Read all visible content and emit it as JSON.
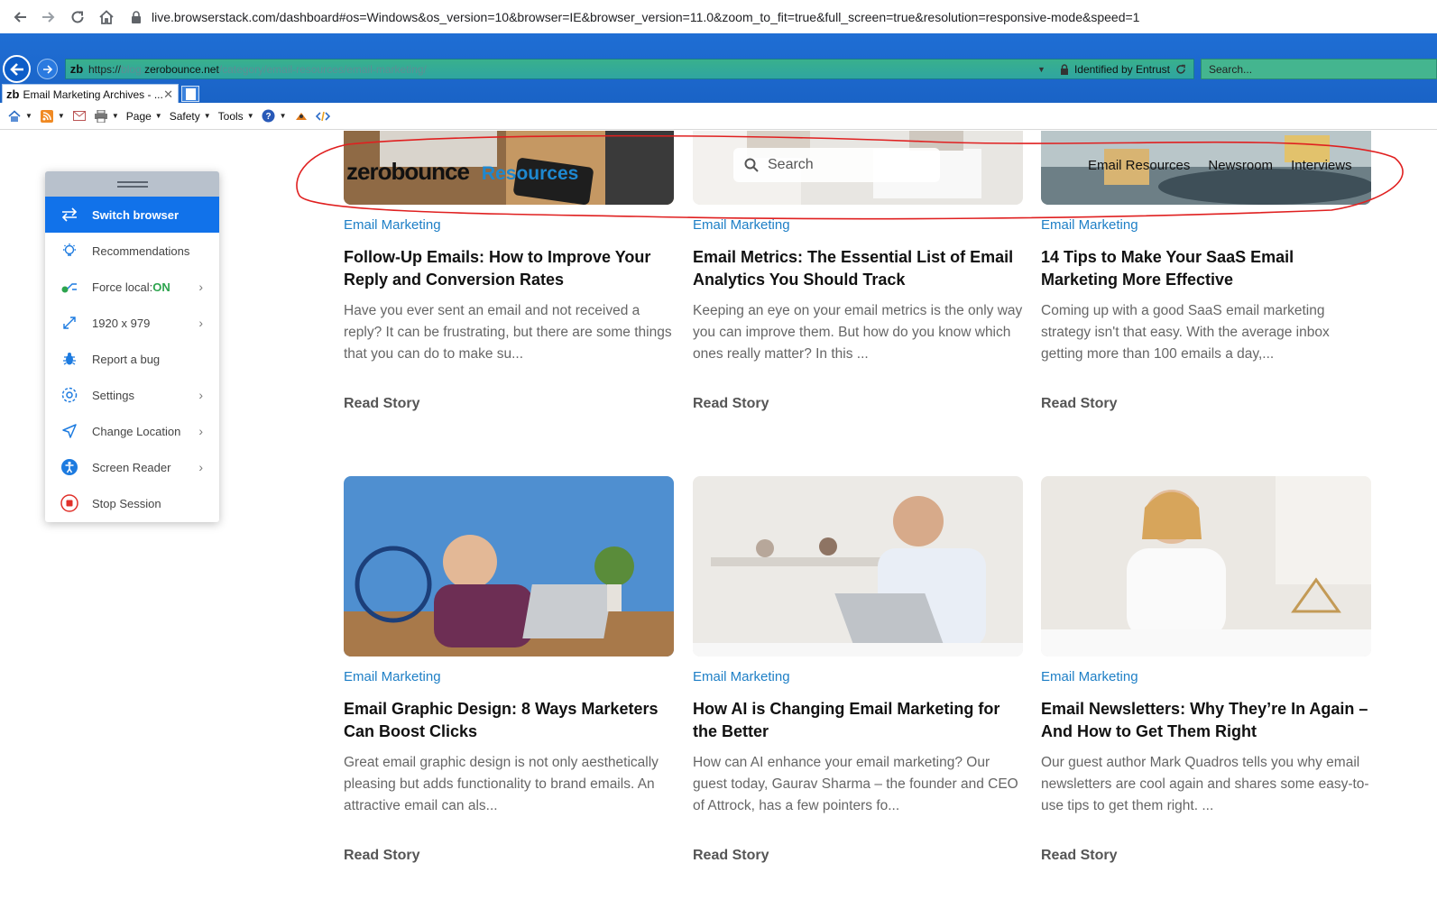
{
  "chrome": {
    "url": "live.browserstack.com/dashboard#os=Windows&os_version=10&browser=IE&browser_version=11.0&zoom_to_fit=true&full_screen=true&resolution=responsive-mode&speed=1"
  },
  "ie": {
    "address": {
      "scheme": "https://",
      "subdomain": "blog.",
      "domain": "zerobounce.net",
      "path": "/category/email-resources/email-marketing/",
      "identity": "Identified by Entrust"
    },
    "search_placeholder": "Search...",
    "tab": {
      "favicon": "zb",
      "title": "Email Marketing Archives - ..."
    },
    "commandbar": {
      "page": "Page",
      "safety": "Safety",
      "tools": "Tools"
    }
  },
  "site": {
    "logo": "zerobounce",
    "logo_suffix": "Resources",
    "search_placeholder": "Search",
    "nav": [
      "Email Resources",
      "Newsroom",
      "Interviews"
    ]
  },
  "cards": [
    {
      "category": "Email Marketing",
      "title": "Follow-Up Emails: How to Improve Your Reply and Conversion Rates",
      "excerpt": "Have you ever sent an email and not received a reply? It can be frustrating, but there are some things that you can do to make su...",
      "cta": "Read Story"
    },
    {
      "category": "Email Marketing",
      "title": "Email Metrics: The Essential List of Email Analytics You Should Track",
      "excerpt": "Keeping an eye on your email metrics is the only way you can improve them. But how do you know which ones really matter? In this ...",
      "cta": "Read Story"
    },
    {
      "category": "Email Marketing",
      "title": "14 Tips to Make Your SaaS Email Marketing More Effective",
      "excerpt": "Coming up with a good SaaS email marketing strategy isn't that easy. With the average inbox getting more than 100 emails a day,...",
      "cta": "Read Story"
    },
    {
      "category": "Email Marketing",
      "title": "Email Graphic Design: 8 Ways Marketers Can Boost Clicks",
      "excerpt": "Great email graphic design is not only aesthetically pleasing but adds functionality to brand emails. An attractive email can als...",
      "cta": "Read Story"
    },
    {
      "category": "Email Marketing",
      "title": "How AI is Changing Email Marketing for the Better",
      "excerpt": "How can AI enhance your email marketing? Our guest today, Gaurav Sharma – the founder and CEO of Attrock, has a few pointers fo...",
      "cta": "Read Story"
    },
    {
      "category": "Email Marketing",
      "title": "Email Newsletters: Why They’re In Again – And How to Get Them Right",
      "excerpt": "Our guest author Mark Quadros tells you why email newsletters are cool again and shares some easy-to-use tips to get them right. ...",
      "cta": "Read Story"
    }
  ],
  "browserstack_panel": {
    "items": [
      {
        "label": "Switch browser",
        "icon": "switch-icon",
        "active": true
      },
      {
        "label": "Recommendations",
        "icon": "bulb-icon"
      },
      {
        "label": "Force local: ",
        "value": "ON",
        "icon": "local-icon",
        "chevron": true
      },
      {
        "label": "1920 x 979",
        "icon": "resize-icon",
        "chevron": true
      },
      {
        "label": "Report a bug",
        "icon": "bug-icon"
      },
      {
        "label": "Settings",
        "icon": "gear-icon",
        "chevron": true
      },
      {
        "label": "Change Location",
        "icon": "location-icon",
        "chevron": true
      },
      {
        "label": "Screen Reader",
        "icon": "accessibility-icon",
        "chevron": true
      },
      {
        "label": "Stop Session",
        "icon": "stop-icon"
      }
    ]
  },
  "colors": {
    "ie_blue": "#1f6ed4",
    "address_green": "#39b08d",
    "link_blue": "#1e7fc6",
    "panel_active": "#1172ea",
    "annotation_red": "#e02020",
    "on_green": "#2da44e"
  }
}
